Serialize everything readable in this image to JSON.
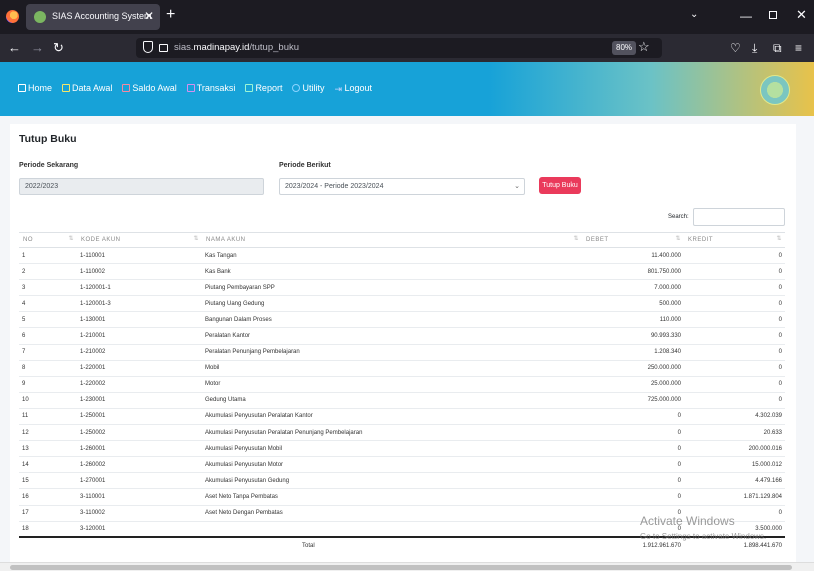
{
  "browser": {
    "tab_title": "SIAS Accounting System",
    "url_prefix": "sias.",
    "url_domain": "madinapay.id",
    "url_path": "/tutup_buku",
    "zoom": "80%"
  },
  "menu": {
    "items": [
      {
        "label": "Home"
      },
      {
        "label": "Data Awal"
      },
      {
        "label": "Saldo Awal"
      },
      {
        "label": "Transaksi"
      },
      {
        "label": "Report"
      },
      {
        "label": "Utility"
      },
      {
        "label": "Logout"
      }
    ]
  },
  "page": {
    "title": "Tutup Buku",
    "periode_sekarang_label": "Periode Sekarang",
    "periode_sekarang_value": "2022/2023",
    "periode_berikut_label": "Periode Berikut",
    "periode_berikut_value": "2023/2024 - Periode 2023/2024",
    "tutup_buku_button": "Tutup Buku",
    "search_label": "Search:"
  },
  "table": {
    "headers": {
      "no": "NO",
      "kode": "KODE AKUN",
      "nama": "NAMA AKUN",
      "debet": "DEBET",
      "kredit": "KREDIT"
    },
    "rows": [
      {
        "no": "1",
        "kode": "1-110001",
        "nama": "Kas Tangan",
        "debet": "11.400.000",
        "kredit": "0"
      },
      {
        "no": "2",
        "kode": "1-110002",
        "nama": "Kas Bank",
        "debet": "801.750.000",
        "kredit": "0"
      },
      {
        "no": "3",
        "kode": "1-120001-1",
        "nama": "Piutang Pembayaran SPP",
        "debet": "7.000.000",
        "kredit": "0"
      },
      {
        "no": "4",
        "kode": "1-120001-3",
        "nama": "Piutang Uang Gedung",
        "debet": "500.000",
        "kredit": "0"
      },
      {
        "no": "5",
        "kode": "1-130001",
        "nama": "Bangunan Dalam Proses",
        "debet": "110.000",
        "kredit": "0"
      },
      {
        "no": "6",
        "kode": "1-210001",
        "nama": "Peralatan Kantor",
        "debet": "90.993.330",
        "kredit": "0"
      },
      {
        "no": "7",
        "kode": "1-210002",
        "nama": "Peralatan Penunjang Pembelajaran",
        "debet": "1.208.340",
        "kredit": "0"
      },
      {
        "no": "8",
        "kode": "1-220001",
        "nama": "Mobil",
        "debet": "250.000.000",
        "kredit": "0"
      },
      {
        "no": "9",
        "kode": "1-220002",
        "nama": "Motor",
        "debet": "25.000.000",
        "kredit": "0"
      },
      {
        "no": "10",
        "kode": "1-230001",
        "nama": "Gedung Utama",
        "debet": "725.000.000",
        "kredit": "0"
      },
      {
        "no": "11",
        "kode": "1-250001",
        "nama": "Akumulasi Penyusutan Peralatan Kantor",
        "debet": "0",
        "kredit": "4.302.039"
      },
      {
        "no": "12",
        "kode": "1-250002",
        "nama": "Akumulasi Penyusutan Peralatan Penunjang Pembelajaran",
        "debet": "0",
        "kredit": "20.633"
      },
      {
        "no": "13",
        "kode": "1-260001",
        "nama": "Akumulasi Penyusutan Mobil",
        "debet": "0",
        "kredit": "200.000.016"
      },
      {
        "no": "14",
        "kode": "1-260002",
        "nama": "Akumulasi Penyusutan Motor",
        "debet": "0",
        "kredit": "15.000.012"
      },
      {
        "no": "15",
        "kode": "1-270001",
        "nama": "Akumulasi Penyusutan Gedung",
        "debet": "0",
        "kredit": "4.479.166"
      },
      {
        "no": "16",
        "kode": "3-110001",
        "nama": "Aset Neto Tanpa Pembatas",
        "debet": "0",
        "kredit": "1.871.129.804"
      },
      {
        "no": "17",
        "kode": "3-110002",
        "nama": "Aset Neto Dengan Pembatas",
        "debet": "0",
        "kredit": "0"
      },
      {
        "no": "18",
        "kode": "3-120001",
        "nama": "",
        "debet": "0",
        "kredit": "3.500.000"
      }
    ],
    "total_label": "Total",
    "total_debet": "1.912.961.670",
    "total_kredit": "1.898.441.670"
  },
  "watermark": {
    "line1": "Activate Windows",
    "line2": "Go to Settings to activate Windows."
  }
}
